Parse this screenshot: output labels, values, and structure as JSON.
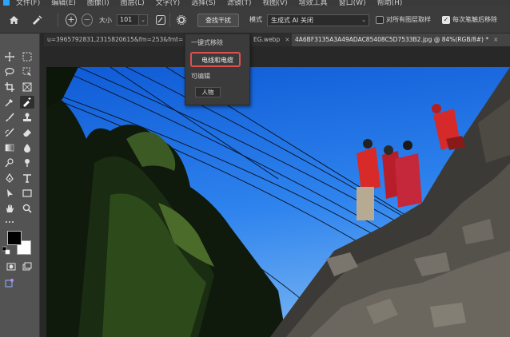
{
  "app": {
    "menu": [
      "文件(F)",
      "编辑(E)",
      "图像(I)",
      "图层(L)",
      "文字(Y)",
      "选择(S)",
      "滤镜(T)",
      "视图(V)",
      "增效工具",
      "窗口(W)",
      "帮助(H)"
    ]
  },
  "options_bar": {
    "size_label": "大小",
    "size_value": "101",
    "find_button": "查找干扰",
    "mode_label": "模式",
    "mode_value": "生成式 AI 关闭",
    "sample_all_layers_label": "对所有图层取样",
    "sample_all_layers_checked": false,
    "after_each_stroke_label": "每次笔触后移除",
    "after_each_stroke_checked": true
  },
  "tabs": [
    {
      "label": "u=3965792831,2315820615&fm=253&fmt=",
      "active": false
    },
    {
      "label": "EG.webp",
      "active": false
    },
    {
      "label": "4A6BF3135A3A49ADAC85408C5D7533B2.jpg @ 84%(RGB/8#) *",
      "active": true
    }
  ],
  "dropdown": {
    "section_one_click": "一键式移除",
    "item_wires": "电线和电缆",
    "section_editable": "可编辑",
    "item_people": "人物"
  },
  "colors": {
    "accent_highlight": "#e05050",
    "foreground": "#000000",
    "background": "#ffffff"
  }
}
